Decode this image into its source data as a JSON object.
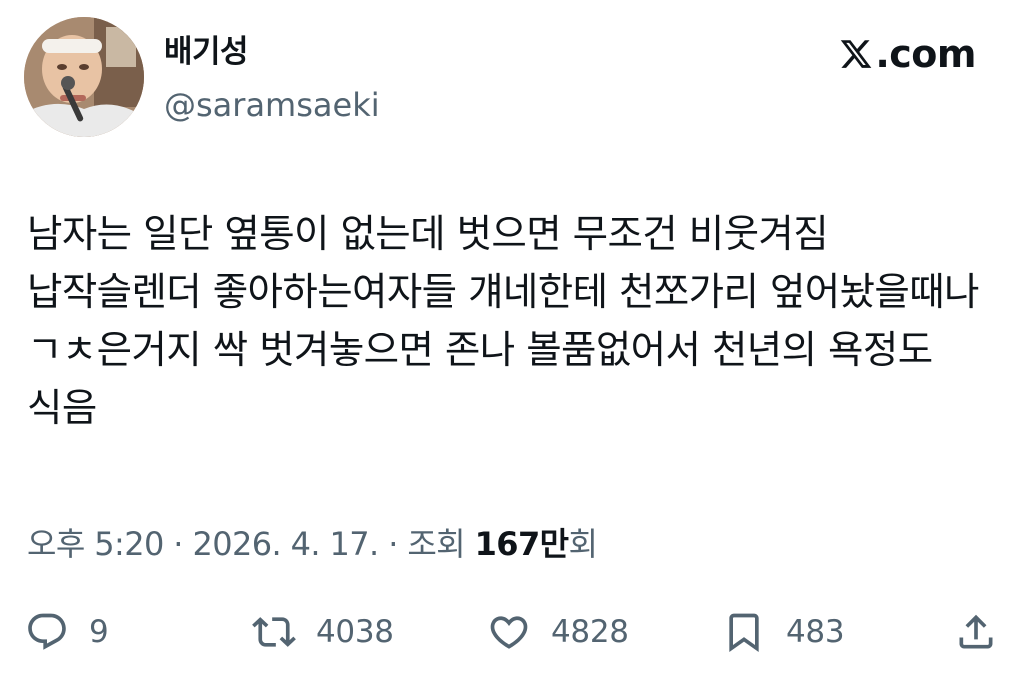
{
  "author": {
    "display_name": "배기성",
    "handle": "@saramsaeki"
  },
  "brand": {
    "label": ".com",
    "icon": "x-logo-icon"
  },
  "tweet": {
    "text": "남자는 일단 옆통이 없는데 벗으면 무조건 비웃겨짐 납작슬렌더 좋아하는여자들 걔네한테 천쪼가리 엎어놨을때나 ㄱㅊ은거지 싹 벗겨놓으면 존나 볼품없어서 천년의 욕정도 식음"
  },
  "meta": {
    "time": "오후 5:20",
    "separator1": " · ",
    "date": "2026. 4. 17.",
    "separator2": " · ",
    "views_label": "조회 ",
    "views_count": "167만",
    "views_suffix": "회"
  },
  "actions": {
    "reply": {
      "icon": "reply-icon",
      "count": "9"
    },
    "repost": {
      "icon": "repost-icon",
      "count": "4038"
    },
    "like": {
      "icon": "heart-icon",
      "count": "4828"
    },
    "bookmark": {
      "icon": "bookmark-icon",
      "count": "483"
    },
    "share": {
      "icon": "share-icon"
    }
  },
  "colors": {
    "text": "#0f1419",
    "secondary": "#536471",
    "background": "#ffffff"
  }
}
